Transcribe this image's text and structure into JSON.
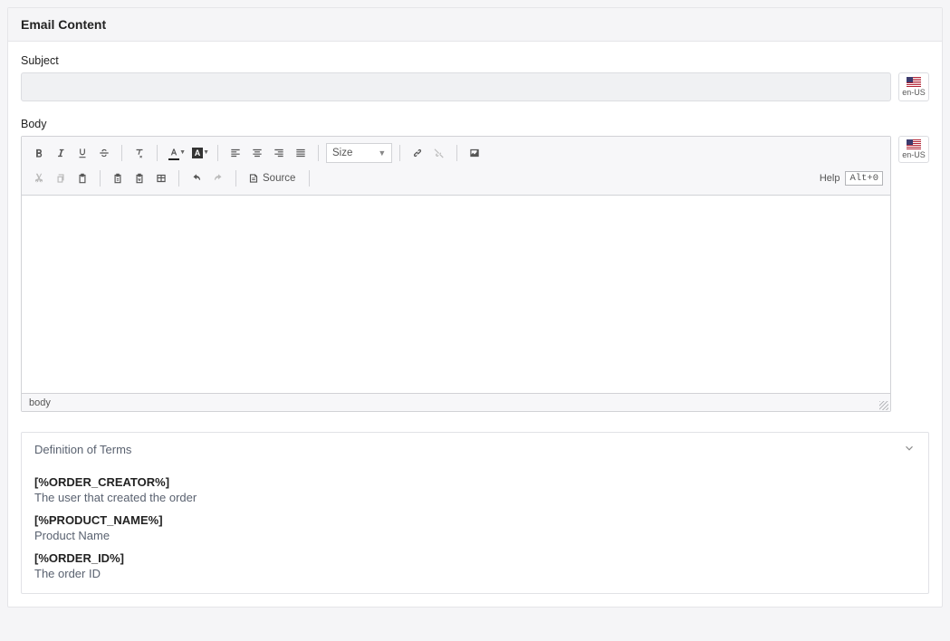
{
  "panel": {
    "title": "Email Content"
  },
  "subject": {
    "label": "Subject",
    "value": "",
    "placeholder": ""
  },
  "body": {
    "label": "Body"
  },
  "locale": {
    "code": "en-US"
  },
  "toolbar": {
    "size_label": "Size",
    "source_label": "Source",
    "help_label": "Help",
    "help_shortcut": "Alt+0"
  },
  "editor": {
    "footer_path": "body"
  },
  "terms": {
    "title": "Definition of Terms",
    "items": [
      {
        "token": "[%ORDER_CREATOR%]",
        "desc": "The user that created the order"
      },
      {
        "token": "[%PRODUCT_NAME%]",
        "desc": "Product Name"
      },
      {
        "token": "[%ORDER_ID%]",
        "desc": "The order ID"
      }
    ]
  }
}
